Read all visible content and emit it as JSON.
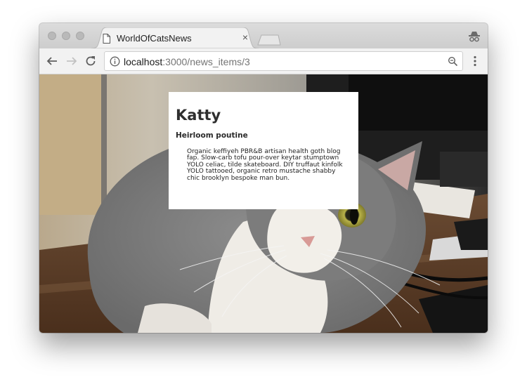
{
  "browser": {
    "tab": {
      "title": "WorldOfCatsNews",
      "close_glyph": "×"
    },
    "address_bar": {
      "host": "localhost",
      "path": ":3000/news_items/3"
    },
    "icons": {
      "tab": "document-icon",
      "close": "close-icon",
      "new_tab": "new-tab-icon",
      "incognito": "incognito-icon",
      "back": "back-arrow-icon",
      "forward": "forward-arrow-icon",
      "reload": "reload-icon",
      "site_info": "info-icon",
      "zoom": "zoom-icon",
      "menu": "kebab-menu-icon"
    }
  },
  "page": {
    "background_image": "gray-and-white-cat-photo",
    "article": {
      "headline": "Katty",
      "subheadline": "Heirloom poutine",
      "body": "Organic keffiyeh PBR&B artisan health goth blog fap. Slow-carb tofu pour-over keytar stumptown YOLO celiac, tilde skateboard. DIY truffaut kinfolk YOLO tattooed, organic retro mustache shabby chic brooklyn bespoke man bun."
    }
  }
}
